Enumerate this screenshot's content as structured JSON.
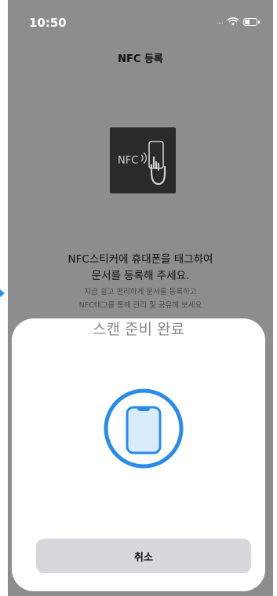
{
  "status_bar": {
    "time": "10:50",
    "signal": "....",
    "wifi_icon": "wifi-icon",
    "battery_icon": "battery-icon"
  },
  "header": {
    "title": "NFC 등록"
  },
  "illustration": {
    "label": "NFC",
    "icon": "nfc-phone-tap-icon"
  },
  "main": {
    "headline_line1": "NFC스티커에 휴대폰을 태그하여",
    "headline_line2": "문서를 등록해 주세요.",
    "sub_line1": "지금 쉽고 편리하게 문서를 등록하고",
    "sub_line2": "NFC태그를 통해 관리 및 공유해 보세요"
  },
  "scan_sheet": {
    "title": "스캔 준비 완료",
    "icon": "phone-scan-icon",
    "accent_color": "#2b8be6",
    "cancel_label": "취소"
  }
}
